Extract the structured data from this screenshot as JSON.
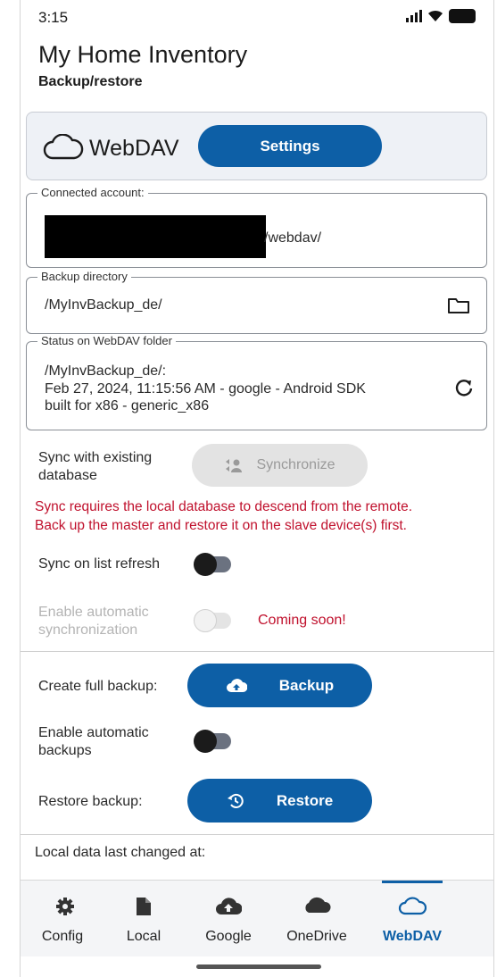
{
  "status_bar": {
    "time": "3:15"
  },
  "header": {
    "title": "My Home Inventory",
    "subtitle": "Backup/restore"
  },
  "webdav_card": {
    "label": "WebDAV",
    "settings_button": "Settings"
  },
  "connected_account": {
    "legend": "Connected account:",
    "value": "/webdav/"
  },
  "backup_directory": {
    "legend": "Backup directory",
    "value": "/MyInvBackup_de/"
  },
  "status_folder": {
    "legend": "Status on WebDAV folder",
    "line1": "/MyInvBackup_de/:",
    "line2": "Feb 27, 2024, 11:15:56 AM - google - Android SDK",
    "line3": "built for x86 - generic_x86"
  },
  "sync": {
    "label_line1": "Sync with existing",
    "label_line2": "database",
    "button": "Synchronize",
    "warning_line1": "Sync requires the local database to descend from the remote.",
    "warning_line2": "Back up the master and restore it on the slave device(s) first.",
    "refresh_label": "Sync on list refresh",
    "auto_label_line1": "Enable automatic",
    "auto_label_line2": "synchronization",
    "coming_soon": "Coming soon!"
  },
  "backup": {
    "create_label": "Create full backup:",
    "create_button": "Backup",
    "auto_label_line1": "Enable automatic",
    "auto_label_line2": "backups",
    "restore_label": "Restore backup:",
    "restore_button": "Restore"
  },
  "local_data": {
    "label": "Local data last changed at:"
  },
  "nav": {
    "items": [
      {
        "label": "Config",
        "icon": "gear-icon"
      },
      {
        "label": "Local",
        "icon": "file-icon"
      },
      {
        "label": "Google",
        "icon": "cloud-upload-icon"
      },
      {
        "label": "OneDrive",
        "icon": "cloud-filled-icon"
      },
      {
        "label": "WebDAV",
        "icon": "cloud-outline-icon"
      }
    ],
    "active": "WebDAV"
  },
  "colors": {
    "accent": "#0d5fa6",
    "warning": "#c0112d",
    "coming_soon": "#c0112d"
  }
}
